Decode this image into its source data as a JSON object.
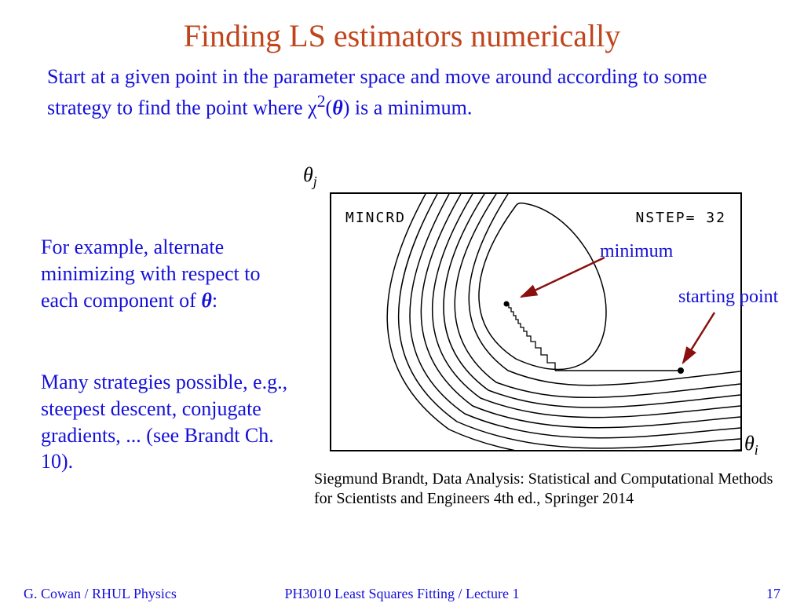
{
  "title": "Finding LS estimators numerically",
  "intro_a": "Start at a given point in the parameter space and move around according to some strategy to find the point where ",
  "intro_chi": "χ",
  "intro_sup": "2",
  "intro_theta": "θ",
  "intro_b": " is a minimum.",
  "para1_a": "For example, alternate minimizing with respect to each component of ",
  "para1_theta": "θ",
  "para1_b": ":",
  "para2": "Many strategies possible, e.g., steepest descent, conjugate gradients, ... (see Brandt Ch. 10).",
  "axis_j": "θ",
  "axis_j_sub": "j",
  "axis_i": "θ",
  "axis_i_sub": "i",
  "fig_mincrd": "MINCRD",
  "fig_nstep": "NSTEP=  32",
  "ann_min": "minimum",
  "ann_start": "starting point",
  "citation": "Siegmund Brandt, Data Analysis: Statistical and Computational Methods for Scientists and Engineers 4th ed., Springer 2014",
  "footer_left": "G. Cowan / RHUL Physics",
  "footer_center": "PH3010 Least Squares Fitting / Lecture 1",
  "footer_right": "17"
}
